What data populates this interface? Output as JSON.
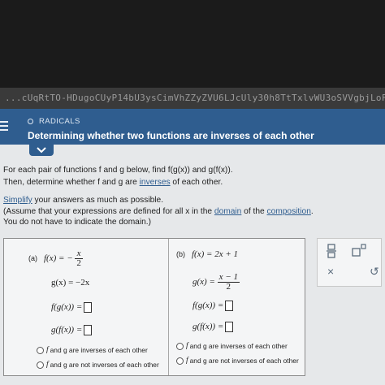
{
  "browser": {
    "url_fragment": "...cUqRtTO-HDugoCUyP14bU3ysCimVhZZyZVU6LJcUly30h8TtTxlvWU3oSVVgbjLoF"
  },
  "header": {
    "topic": "RADICALS",
    "title": "Determining whether two functions are inverses of each other"
  },
  "instructions": {
    "line1": "For each pair of functions f and g below, find f(g(x)) and g(f(x)).",
    "line2_prefix": "Then, determine whether f and g are ",
    "line2_link": "inverses",
    "line2_suffix": " of each other.",
    "simplify_link": "Simplify",
    "simplify_rest": " your answers as much as possible.",
    "assume_prefix": "(Assume that your expressions are defined for all x in the ",
    "domain_link": "domain",
    "assume_mid": " of the ",
    "composition_link": "composition",
    "assume_suffix": ".",
    "line5": "You do not have to indicate the domain.)"
  },
  "part_a": {
    "label": "(a)",
    "f_lhs": "f(x)  =  −",
    "f_num": "x",
    "f_den": "2",
    "g_expr": "g(x)  =  −2x",
    "fog_label": "f(g(x))  =",
    "gof_label": "g(f(x))  =",
    "option_inverse_f": "f",
    "option_inverse_text": "and g are inverses of each other",
    "option_not_f": "f",
    "option_not_text": "and g are not inverses of each other"
  },
  "part_b": {
    "label": "(b)",
    "f_expr": "f(x)  =  2x + 1",
    "g_lhs": "g(x)  =",
    "g_num": "x − 1",
    "g_den": "2",
    "fog_label": "f(g(x))  =",
    "gof_label": "g(f(x))  =",
    "option_inverse_f": "f",
    "option_inverse_text": "and g are inverses of each other",
    "option_not_f": "f",
    "option_not_text": "and g are not inverses of each other"
  },
  "toolbar": {
    "fraction_icon": "fraction-icon",
    "exponent_icon": "exponent-icon",
    "clear_glyph": "×",
    "undo_glyph": "↺"
  },
  "colors": {
    "header_bg": "#2f5d8f",
    "link": "#2f5d8f",
    "content_bg": "#e6e8ea"
  }
}
